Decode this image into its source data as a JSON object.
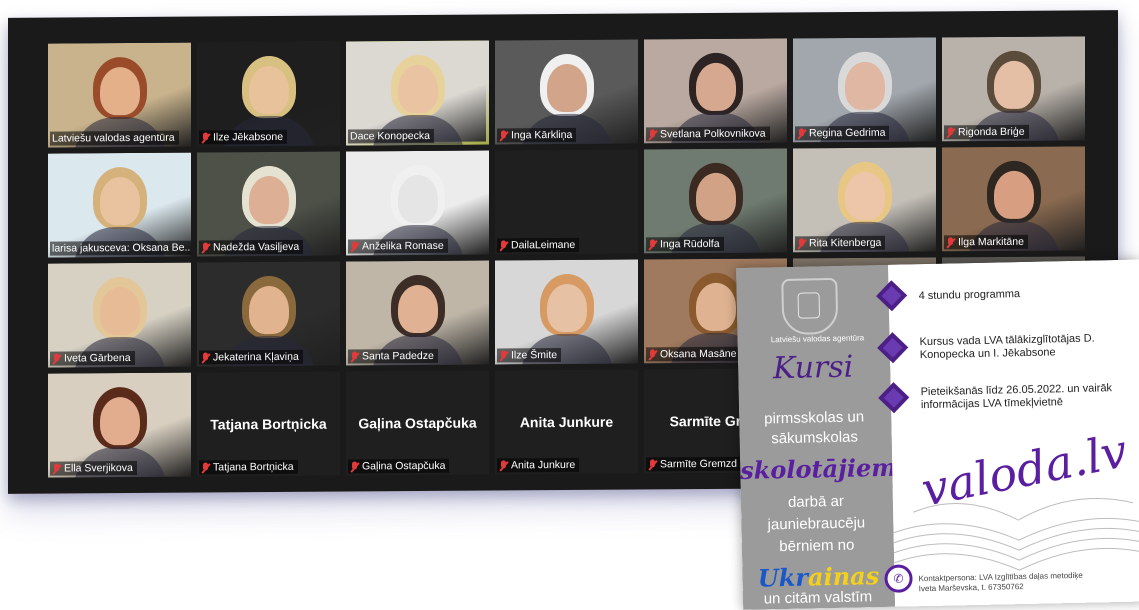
{
  "zoom": {
    "tiles": [
      {
        "id": "t1",
        "label": "Latviešu valodas agentūra",
        "muted": false,
        "video": true,
        "bg": "#c9b38c",
        "skin": "#e3b08a",
        "hair": "#9a4b2a",
        "active": false
      },
      {
        "id": "t2",
        "label": "Ilze Jēkabsone",
        "muted": true,
        "video": true,
        "bg": "#1e1e1e",
        "skin": "#e7c29a",
        "hair": "#d8c080",
        "active": false
      },
      {
        "id": "t3",
        "label": "Dace Konopecka",
        "muted": false,
        "video": true,
        "bg": "#dcd9d3",
        "skin": "#eac3a2",
        "hair": "#e7d29b",
        "active": true
      },
      {
        "id": "t4",
        "label": "Inga Kārkliņa",
        "muted": true,
        "video": true,
        "bg": "#5a5a5a",
        "skin": "#d2a48a",
        "hair": "#f0f0f0",
        "active": false
      },
      {
        "id": "t5",
        "label": "Svetlana Polkovnikova",
        "muted": true,
        "video": true,
        "bg": "#b9a9a0",
        "skin": "#d7a890",
        "hair": "#2d2323",
        "active": false
      },
      {
        "id": "t6",
        "label": "Regina Gedrima",
        "muted": true,
        "video": true,
        "bg": "#a1a7ad",
        "skin": "#dfb7a3",
        "hair": "#d9d9d9",
        "active": false
      },
      {
        "id": "t7",
        "label": "Rigonda Briģe",
        "muted": true,
        "video": true,
        "bg": "#b8b2aa",
        "skin": "#e4bfa6",
        "hair": "#5b4b3b",
        "active": false
      },
      {
        "id": "t8",
        "label": "larisa jakusceva: Oksana Be...",
        "muted": false,
        "video": true,
        "bg": "#dbe8ee",
        "skin": "#e9c39f",
        "hair": "#d5b27c",
        "active": false
      },
      {
        "id": "t9",
        "label": "Nadežda Vasiļjeva",
        "muted": true,
        "video": true,
        "bg": "#4d5148",
        "skin": "#ddb096",
        "hair": "#e5e2d2",
        "active": false
      },
      {
        "id": "t10",
        "label": "Anželika Romase",
        "muted": true,
        "video": true,
        "bg": "#ececec",
        "skin": "#e5e5e5",
        "hair": "#f0f0f0",
        "active": false
      },
      {
        "id": "t11",
        "label": "DailaLeimane",
        "muted": true,
        "video": false,
        "bg": "#1f1f1f",
        "skin": "#1f1f1f",
        "hair": "#1f1f1f",
        "active": false
      },
      {
        "id": "t12",
        "label": "Inga Rūdolfa",
        "muted": true,
        "video": true,
        "bg": "#6f7b70",
        "skin": "#d2a287",
        "hair": "#3a2a22",
        "active": false
      },
      {
        "id": "t13",
        "label": "Rita Kitenberga",
        "muted": true,
        "video": true,
        "bg": "#c4c0b8",
        "skin": "#edc6a9",
        "hair": "#e8c785",
        "active": false
      },
      {
        "id": "t14",
        "label": "Ilga Markitāne",
        "muted": true,
        "video": true,
        "bg": "#8a6a50",
        "skin": "#d79e82",
        "hair": "#2e2620",
        "active": false
      },
      {
        "id": "t15",
        "label": "Iveta Gārbena",
        "muted": true,
        "video": true,
        "bg": "#d6d1c3",
        "skin": "#e7bb96",
        "hair": "#e3c798",
        "active": false
      },
      {
        "id": "t16",
        "label": "Jekaterina Kļaviņa",
        "muted": true,
        "video": true,
        "bg": "#2c2c2c",
        "skin": "#e1b38f",
        "hair": "#8a6a3c",
        "active": false
      },
      {
        "id": "t17",
        "label": "Santa Padedze",
        "muted": true,
        "video": true,
        "bg": "#bfb6a8",
        "skin": "#e0b293",
        "hair": "#3c2d26",
        "active": false
      },
      {
        "id": "t18",
        "label": "Ilze Šmite",
        "muted": true,
        "video": true,
        "bg": "#d7d7d7",
        "skin": "#e6c1a3",
        "hair": "#d79a62",
        "active": false
      },
      {
        "id": "t19",
        "label": "Oksana Masāne",
        "muted": true,
        "video": true,
        "bg": "#a07a5e",
        "skin": "#dfb391",
        "hair": "#8a5a2e",
        "active": false
      },
      {
        "id": "t20",
        "label": "",
        "muted": false,
        "video": true,
        "bg": "#7d7366",
        "skin": "#d7b192",
        "hair": "#8a7050",
        "active": false
      },
      {
        "id": "t21",
        "label": "",
        "muted": false,
        "video": true,
        "bg": "#5d5a55",
        "skin": "#d7b192",
        "hair": "#4a3b30",
        "active": false
      },
      {
        "id": "t22",
        "label": "Ella Sverjikova",
        "muted": true,
        "video": true,
        "bg": "#d8cfc0",
        "skin": "#e1ad8e",
        "hair": "#5a2a1a",
        "active": false
      },
      {
        "id": "t23",
        "label": "Tatjana Bortņicka",
        "muted": true,
        "video": false,
        "center": "Tatjana Bortņicka",
        "bg": "#1f1f1f",
        "skin": "#1f1f1f",
        "hair": "#1f1f1f",
        "active": false
      },
      {
        "id": "t24",
        "label": "Gaļina Ostapčuka",
        "muted": true,
        "video": false,
        "center": "Gaļina Ostapčuka",
        "bg": "#1f1f1f",
        "skin": "#1f1f1f",
        "hair": "#1f1f1f",
        "active": false
      },
      {
        "id": "t25",
        "label": "Anita Junkure",
        "muted": true,
        "video": false,
        "center": "Anita Junkure",
        "bg": "#1f1f1f",
        "skin": "#1f1f1f",
        "hair": "#1f1f1f",
        "active": false
      },
      {
        "id": "t26",
        "label": "Sarmīte Gremzd",
        "muted": true,
        "video": false,
        "center": "Sarmīte Grem",
        "bg": "#1f1f1f",
        "skin": "#1f1f1f",
        "hair": "#1f1f1f",
        "active": false
      }
    ]
  },
  "flyer": {
    "agency": "Latviešu valodas agentūra",
    "kursi": "Kursi",
    "line1": "pirmsskolas un",
    "line2": "sākumskolas",
    "skolotajiem": "skolotājiem",
    "line3": "darbā ar",
    "line4": "jauniebraucēju",
    "line5": "bērniem no",
    "ukr_part1": "Ukr",
    "ukr_part2": "ainas",
    "line6": "un citām valstīm",
    "bullets": [
      {
        "text": "4 stundu programma"
      },
      {
        "text": "Kursus vada LVA tālākizglītotājas D. Konopecka un I. Jēkabsone"
      },
      {
        "text": "Pieteikšanās līdz 26.05.2022. un vairāk informācijas LVA tīmekļvietnē"
      }
    ],
    "brand": "valoda.lv",
    "contact_line1": "Kontaktpersona: LVA Izglītības daļas metodiķe",
    "contact_line2": "Iveta Marševska, t. 67350762",
    "colors": {
      "purple": "#5a1ea0",
      "gray": "#9b9b9b",
      "ukr_blue": "#1a57c8",
      "ukr_yellow": "#f3d11a"
    }
  }
}
